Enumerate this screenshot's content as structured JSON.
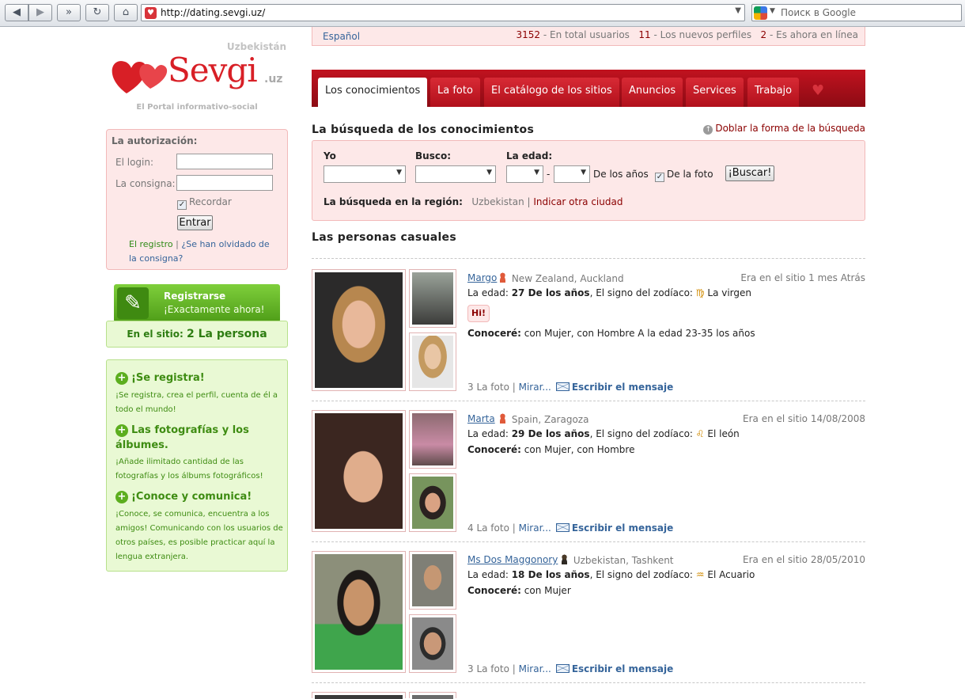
{
  "browser": {
    "url": "http://dating.sevgi.uz/",
    "search_placeholder": "Поиск в Google"
  },
  "header": {
    "language": "Español",
    "stats": [
      {
        "value": "3152",
        "label": " - En total usuarios"
      },
      {
        "value": "11",
        "label": " - Los nuevos perfiles"
      },
      {
        "value": "2",
        "label": " - Es ahora en línea"
      }
    ]
  },
  "logo": {
    "country": "Uzbekistán",
    "name": "Sevgi",
    "tld": ".uz",
    "tagline": "El Portal informativo-social"
  },
  "auth": {
    "title": "La autorización:",
    "login_label": "El login:",
    "password_label": "La consigna:",
    "remember_label": "Recordar",
    "enter_label": "Entrar",
    "register_link": "El registro",
    "separator": "|",
    "forgot_link": "¿Se han olvidado de la consigna?"
  },
  "register_banner": {
    "title": "Registrarse",
    "subtitle": "¡Exactamente ahora!"
  },
  "online": {
    "label": "En el sitio:",
    "link": "2 La persona"
  },
  "info": [
    {
      "title": "¡Se registra!",
      "text": "¡Se registra, crea el perfil, cuenta de él a todo el mundo!"
    },
    {
      "title": "Las fotografías y los álbumes.",
      "text": "¡Añade ilimitado cantidad de las fotografías y los álbums fotográficos!"
    },
    {
      "title": "¡Conoce y comunica!",
      "text": "¡Conoce, se comunica, encuentra a los amigos! Comunicando con los usuarios de otros países, es posible practicar aquí la lengua extranjera."
    }
  ],
  "tabs": [
    {
      "label": "Los conocimientos",
      "active": true
    },
    {
      "label": "La foto"
    },
    {
      "label": "El catálogo de los sitios"
    },
    {
      "label": "Anuncios"
    },
    {
      "label": "Services"
    },
    {
      "label": "Trabajo"
    }
  ],
  "search": {
    "title": "La búsqueda de los conocimientos",
    "double_form_link": "Doblar la forma de la búsqueda",
    "yo_label": "Yo",
    "busco_label": "Busco:",
    "edad_label": "La edad:",
    "dash": "-",
    "years_label": "De los años",
    "photo_label": "De la foto",
    "button": "¡Buscar!",
    "region_label": "La búsqueda en la región:",
    "region_value": "Uzbekistan",
    "region_sep": "|",
    "other_city_link": "Indicar otra ciudad"
  },
  "people_title": "Las personas casuales",
  "people": [
    {
      "name": "Margo",
      "gender": "female",
      "location": "New Zealand, Auckland",
      "seen": "Era en el sitio 1 mes Atrás",
      "age_label": "La edad:",
      "age": "27 De los años",
      "zodiac_label": ", El signo del zodíaco:",
      "zodiac_symbol": "♍",
      "zodiac": "La virgen",
      "hi": "Hi!",
      "meet_label": "Conoceré:",
      "meet": "con Mujer, con Hombre A la edad 23-35 los años",
      "photos_count": "3 La foto",
      "view_link": "Mirar...",
      "message_link": "Escribir el mensaje",
      "colors": {
        "main": "#3a2a22",
        "s1": "#6b6f63",
        "s2": "#b38a55"
      }
    },
    {
      "name": "Marta",
      "gender": "female",
      "location": "Spain, Zaragoza",
      "seen": "Era en el sitio 14/08/2008",
      "age_label": "La edad:",
      "age": "29 De los años",
      "zodiac_label": ", El signo del zodíaco:",
      "zodiac_symbol": "♌",
      "zodiac": "El león",
      "meet_label": "Conoceré:",
      "meet": "con Mujer, con Hombre",
      "photos_count": "4 La foto",
      "view_link": "Mirar...",
      "message_link": "Escribir el mensaje",
      "colors": {
        "main": "#4b2f27",
        "s1": "#7b4a5a",
        "s2": "#5b7a55"
      }
    },
    {
      "name": "Ms Dos Maggonory",
      "gender": "male",
      "location": "Uzbekistan, Tashkent",
      "seen": "Era en el sitio 28/05/2010",
      "age_label": "La edad:",
      "age": "18 De los años",
      "zodiac_label": ", El signo del zodíaco:",
      "zodiac_symbol": "♒",
      "zodiac": "El Acuario",
      "meet_label": "Conoceré:",
      "meet": "con Mujer",
      "photos_count": "3 La foto",
      "view_link": "Mirar...",
      "message_link": "Escribir el mensaje",
      "colors": {
        "main": "#5d7f4a",
        "s1": "#8a8a7e",
        "s2": "#6c6c6c"
      }
    }
  ],
  "colors": {
    "brand": "#d81f26",
    "tab_bar": "#b1101b",
    "green": "#4f9d18",
    "pink_bg": "#fde8e8",
    "link_blue": "#35649a"
  }
}
